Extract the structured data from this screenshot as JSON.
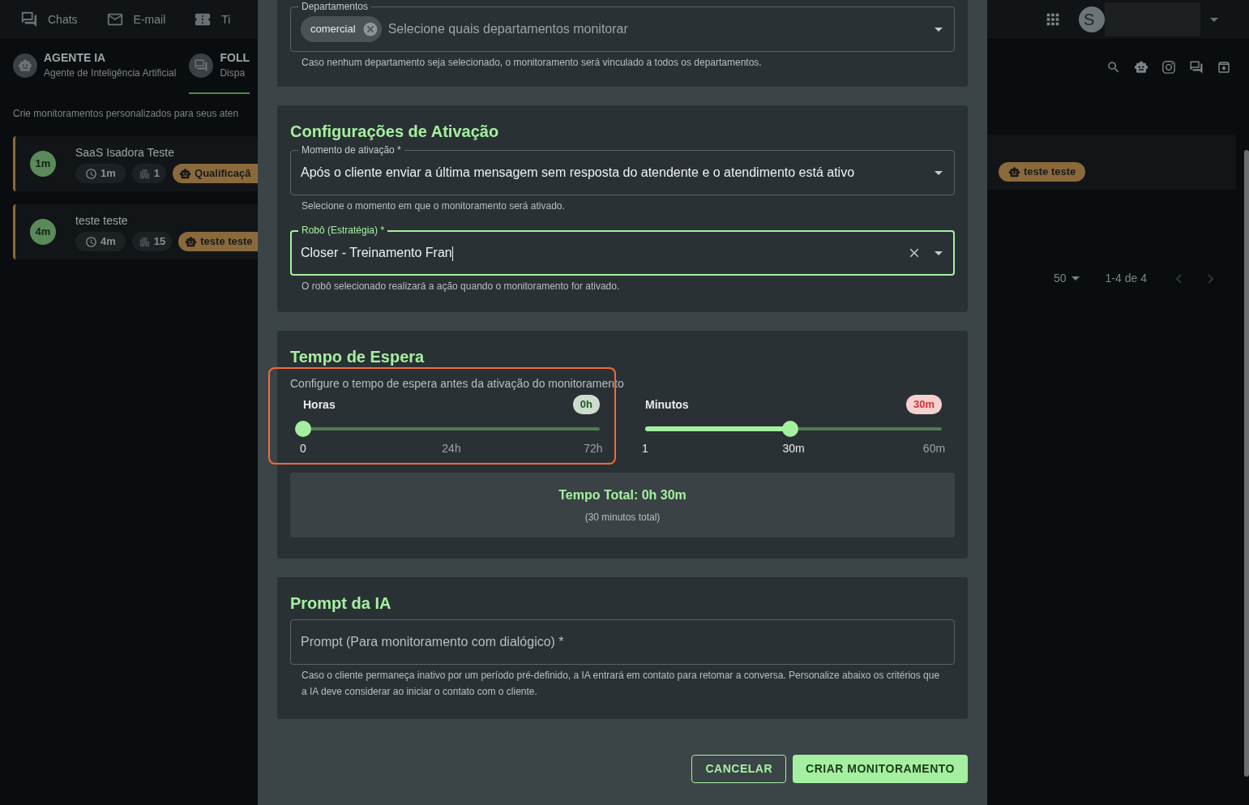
{
  "topnav": {
    "items": [
      {
        "label": "Chats",
        "kind": "chats"
      },
      {
        "label": "E-mail",
        "kind": "email"
      },
      {
        "label": "Ti",
        "kind": "ticket"
      }
    ],
    "avatar_letter": "S"
  },
  "agent_tabs": [
    {
      "title": "AGENTE IA",
      "subtitle": "Agente de Inteligência Artificial",
      "selected": false
    },
    {
      "title": "FOLL",
      "subtitle": "Dispa",
      "selected": true
    }
  ],
  "intro": "Crie monitoramentos personalizados para seus aten",
  "monitors": [
    {
      "badge": "1m",
      "name": "SaaS Isadora Teste",
      "time": "1m",
      "departments": "1",
      "robot": "Qualificaçã",
      "robot_right": "teste teste"
    },
    {
      "badge": "4m",
      "name": "teste teste",
      "time": "4m",
      "departments": "15",
      "robot": "teste teste"
    }
  ],
  "pagination": {
    "per_page": "50",
    "range": "1-4 de 4"
  },
  "modal": {
    "departments": {
      "label": "Departamentos",
      "chips": [
        "comercial"
      ],
      "placeholder": "Selecione quais departamentos monitorar",
      "helper": "Caso nenhum departamento seja selecionado, o monitoramento será vinculado a todos os departamentos."
    },
    "activation": {
      "title": "Configurações de Ativação",
      "fields": [
        {
          "kind": "select",
          "label": "Momento de ativação *",
          "value": "Após o cliente enviar a última mensagem sem resposta do atendente e o atendimento está ativo",
          "focused": false,
          "helper": "Selecione o momento em que o monitoramento será ativado."
        },
        {
          "kind": "autocomplete",
          "label": "Robô (Estratégia) *",
          "value": "Closer - Treinamento Fran",
          "focused": true,
          "helper": "O robô selecionado realizará a ação quando o monitoramento for ativado."
        }
      ]
    },
    "wait": {
      "title": "Tempo de Espera",
      "description": "Configure o tempo de espera antes da ativação do monitoramento",
      "sliders": [
        {
          "label": "Horas",
          "chip": "0h",
          "color": "#1b5e20",
          "level": 0,
          "highlighted": true,
          "marks": [
            {
              "label": "0",
              "active": true
            },
            {
              "label": "24h",
              "active": false
            },
            {
              "label": "72h",
              "active": false
            }
          ]
        },
        {
          "label": "Minutos",
          "chip": "30m",
          "color": "#d32f2f",
          "level": 0.49,
          "highlighted": false,
          "marks": [
            {
              "label": "1",
              "active": true
            },
            {
              "label": "30m",
              "active": true
            },
            {
              "label": "60m",
              "active": false
            }
          ]
        }
      ],
      "total": "Tempo Total: 0h 30m",
      "total_note": "(30 minutos total)"
    },
    "prompt": {
      "title": "Prompt da IA",
      "placeholder": "Prompt (Para monitoramento com dialógico) *",
      "helper": "Caso o cliente permaneça inativo por um período pré-definido, a IA entrará em contato para retomar a conversa. Personalize abaixo os critérios que a IA deve considerar ao iniciar o contato com o cliente."
    },
    "buttons": [
      {
        "label": "CANCELAR",
        "kind": "outlined"
      },
      {
        "label": "CRIAR MONITORAMENTO",
        "kind": "contained"
      }
    ]
  }
}
